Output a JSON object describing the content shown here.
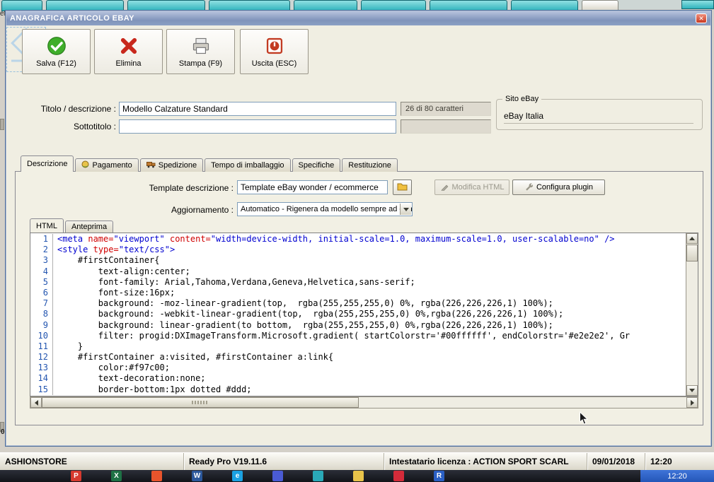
{
  "colors": {
    "accent_teal": "#2fb3bc",
    "titlebar_blue": "#7f93ba",
    "dialog_bg": "#f0eee2",
    "taskbar_clock_blue": "#2456b8"
  },
  "window": {
    "title": "ANAGRAFICA ARTICOLO EBAY",
    "close_glyph": "✕"
  },
  "toolbar": {
    "buttons": [
      {
        "label": "Salva (F12)",
        "icon": "save-check-icon"
      },
      {
        "label": "Elimina",
        "icon": "delete-x-icon"
      },
      {
        "label": "Stampa (F9)",
        "icon": "printer-icon"
      },
      {
        "label": "Uscita (ESC)",
        "icon": "exit-icon"
      }
    ]
  },
  "form": {
    "titolo_label": "Titolo / descrizione :",
    "titolo_value": "Modello Calzature Standard",
    "counter_value": "26 di 80 caratteri",
    "sottotitolo_label": "Sottotitolo :",
    "sottotitolo_value": "",
    "sito_group_label": "Sito eBay",
    "sito_value": "eBay Italia"
  },
  "tabs": {
    "items": [
      {
        "label": "Descrizione",
        "active": true
      },
      {
        "label": "Pagamento",
        "icon": "payment-coin-icon"
      },
      {
        "label": "Spedizione",
        "icon": "shipping-truck-icon"
      },
      {
        "label": "Tempo di imballaggio"
      },
      {
        "label": "Specifiche"
      },
      {
        "label": "Restituzione"
      }
    ]
  },
  "descrizione_tab": {
    "template_label": "Template descrizione :",
    "template_value": "Template eBay wonder / ecommerce",
    "browse_icon": "folder-icon",
    "modifica_html_label": "Modifica HTML",
    "modifica_html_enabled": false,
    "configura_plugin_label": "Configura plugin",
    "aggiornamento_label": "Aggiornamento :",
    "aggiornamento_value": "Automatico - Rigenera da modello sempre ad ogni sincronizzazione"
  },
  "editor": {
    "tabs": [
      {
        "label": "HTML",
        "active": true
      },
      {
        "label": "Anteprima",
        "active": false
      }
    ],
    "syntax_colors": {
      "tag": "#0000d0",
      "attr": "#d00000",
      "plain": "#000000",
      "line_no": "#2456b0"
    },
    "lines": [
      {
        "n": 1,
        "t": [
          [
            "<meta",
            "tag"
          ],
          [
            " ",
            "plain"
          ],
          [
            "name=",
            "attr"
          ],
          [
            "\"viewport\"",
            "tag"
          ],
          [
            " ",
            "plain"
          ],
          [
            "content=",
            "attr"
          ],
          [
            "\"width=device-width, initial-scale=1.0, maximum-scale=1.0, user-scalable=no\"",
            "tag"
          ],
          [
            " />",
            "tag"
          ]
        ]
      },
      {
        "n": 2,
        "t": [
          [
            "<style",
            "tag"
          ],
          [
            " ",
            "plain"
          ],
          [
            "type=",
            "attr"
          ],
          [
            "\"text/css\"",
            "tag"
          ],
          [
            ">",
            "tag"
          ]
        ]
      },
      {
        "n": 3,
        "t": [
          [
            "    #firstContainer{",
            "plain"
          ]
        ]
      },
      {
        "n": 4,
        "t": [
          [
            "        text-align:center;",
            "plain"
          ]
        ]
      },
      {
        "n": 5,
        "t": [
          [
            "        font-family: Arial,Tahoma,Verdana,Geneva,Helvetica,sans-serif;",
            "plain"
          ]
        ]
      },
      {
        "n": 6,
        "t": [
          [
            "        font-size:16px;",
            "plain"
          ]
        ]
      },
      {
        "n": 7,
        "t": [
          [
            "        background: -moz-linear-gradient(top,  rgba(255,255,255,0) 0%, rgba(226,226,226,1) 100%);",
            "plain"
          ]
        ]
      },
      {
        "n": 8,
        "t": [
          [
            "        background: -webkit-linear-gradient(top,  rgba(255,255,255,0) 0%,rgba(226,226,226,1) 100%);",
            "plain"
          ]
        ]
      },
      {
        "n": 9,
        "t": [
          [
            "        background: linear-gradient(to bottom,  rgba(255,255,255,0) 0%,rgba(226,226,226,1) 100%);",
            "plain"
          ]
        ]
      },
      {
        "n": 10,
        "t": [
          [
            "        filter: progid:DXImageTransform.Microsoft.gradient( startColorstr='#00ffffff', endColorstr='#e2e2e2', Gr",
            "plain"
          ]
        ]
      },
      {
        "n": 11,
        "t": [
          [
            "    }",
            "plain"
          ]
        ]
      },
      {
        "n": 12,
        "t": [
          [
            "    #firstContainer a:visited, #firstContainer a:link{",
            "plain"
          ]
        ]
      },
      {
        "n": 13,
        "t": [
          [
            "        color:#f97c00;",
            "plain"
          ]
        ]
      },
      {
        "n": 14,
        "t": [
          [
            "        text-decoration:none;",
            "plain"
          ]
        ]
      },
      {
        "n": 15,
        "t": [
          [
            "        border-bottom:1px dotted #ddd;",
            "plain"
          ]
        ]
      }
    ]
  },
  "status_bar": {
    "cells": [
      {
        "text": "ASHIONSTORE"
      },
      {
        "text": "Ready Pro V19.11.6"
      },
      {
        "text": "Intestatario licenza : ACTION SPORT SCARL"
      },
      {
        "text": "09/01/2018"
      },
      {
        "text": "12:20"
      }
    ]
  },
  "taskbar": {
    "clock": "12:20",
    "icons": [
      {
        "name": "pdf-app-icon",
        "glyph": "P",
        "bg": "#d63a2f",
        "fg": "#ffffff"
      },
      {
        "name": "excel-icon",
        "glyph": "X",
        "bg": "#1e7145",
        "fg": "#ffffff"
      },
      {
        "name": "browser-orange-icon",
        "glyph": "",
        "bg": "#e8542c",
        "fg": "#ffffff"
      },
      {
        "name": "word-icon",
        "glyph": "W",
        "bg": "#2b579a",
        "fg": "#ffffff"
      },
      {
        "name": "ie-icon",
        "glyph": "e",
        "bg": "#1ba1e2",
        "fg": "#ffffff"
      },
      {
        "name": "app-indigo-icon",
        "glyph": "",
        "bg": "#4a5bd4",
        "fg": "#ffffff"
      },
      {
        "name": "app-teal-icon",
        "glyph": "",
        "bg": "#2aa9b8",
        "fg": "#ffffff"
      },
      {
        "name": "folder-app-icon",
        "glyph": "",
        "bg": "#e8c34a",
        "fg": "#7a5a10"
      },
      {
        "name": "fruit-red-icon",
        "glyph": "",
        "bg": "#d42b3a",
        "fg": "#ffffff"
      },
      {
        "name": "readypro-icon",
        "glyph": "R",
        "bg": "#2a5fc4",
        "fg": "#ffffff"
      }
    ]
  },
  "fragments": {
    "top_left": "eB",
    "bottom_left": "0"
  }
}
